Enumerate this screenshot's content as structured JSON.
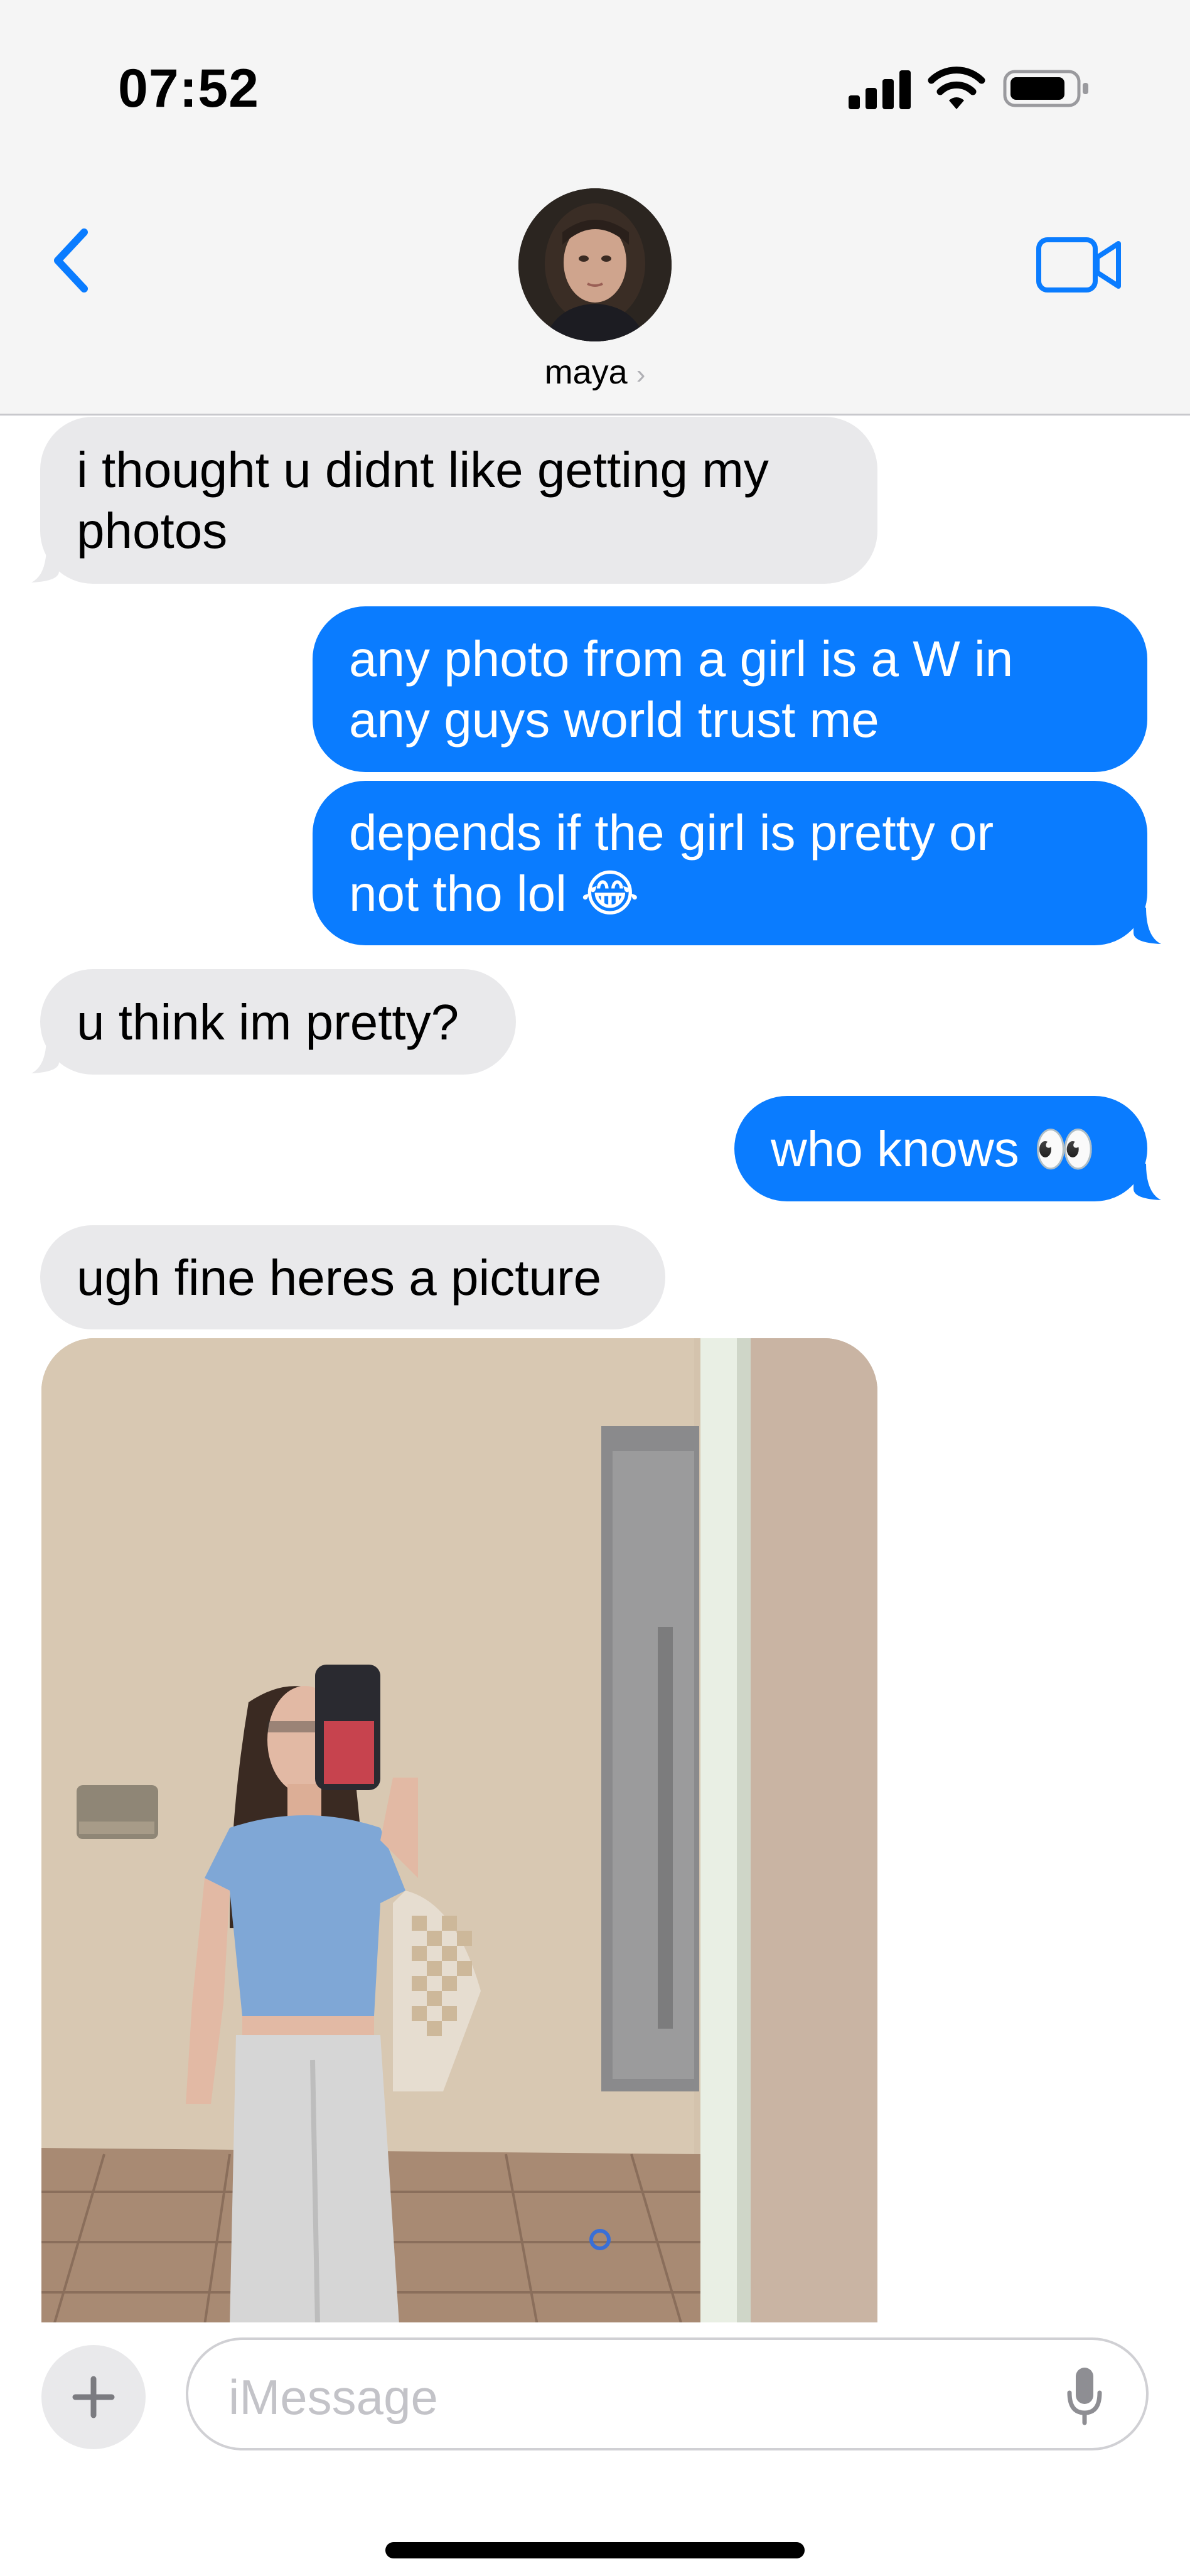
{
  "status_bar": {
    "time": "07:52"
  },
  "header": {
    "contact_name": "maya",
    "chevron": "›"
  },
  "messages": [
    {
      "side": "received",
      "text": "i thought u didnt like getting my photos",
      "lines": [
        "i thought u didnt like getting my",
        "photos"
      ]
    },
    {
      "side": "sent",
      "text": "any photo from a girl is a W in any guys world trust me",
      "lines": [
        "any photo from a girl is a W in",
        "any guys world trust me"
      ]
    },
    {
      "side": "sent",
      "text": "depends if the girl is pretty or not tho lol 😂",
      "lines": [
        "depends if the girl is pretty or",
        "not tho lol 😂"
      ]
    },
    {
      "side": "received",
      "text": "u think im pretty?"
    },
    {
      "side": "sent",
      "text": "who knows 👀"
    },
    {
      "side": "received",
      "text": "ugh fine heres a picture"
    }
  ],
  "input": {
    "placeholder": "iMessage"
  },
  "colors": {
    "sent_bubble": "#0a7cff",
    "received_bubble": "#e9e9eb",
    "accent": "#0a7cff"
  },
  "icons": [
    "signal-icon",
    "wifi-icon",
    "battery-icon",
    "back-chevron-icon",
    "video-call-icon",
    "plus-icon",
    "microphone-icon"
  ]
}
